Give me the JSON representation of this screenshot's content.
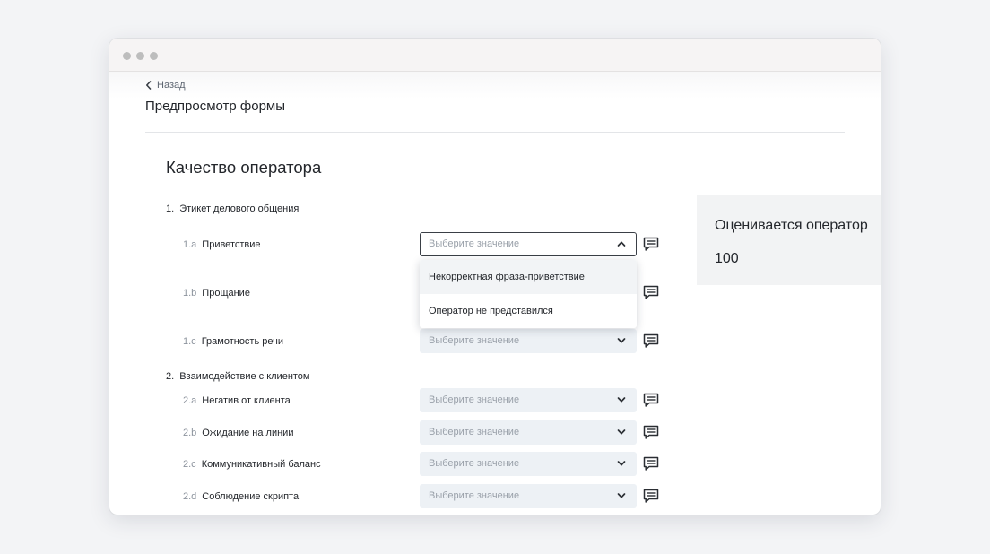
{
  "nav": {
    "back_label": "Назад"
  },
  "page": {
    "title": "Предпросмотр формы"
  },
  "form": {
    "title": "Качество оператора",
    "sections": [
      {
        "number": "1.",
        "title": "Этикет делового общения",
        "items": [
          {
            "code": "1.a",
            "label": "Приветствие",
            "placeholder": "Выберите значение"
          },
          {
            "code": "1.b",
            "label": "Прощание",
            "placeholder": "Выберите значение"
          },
          {
            "code": "1.c",
            "label": "Грамотность речи",
            "placeholder": "Выберите значение"
          }
        ]
      },
      {
        "number": "2.",
        "title": "Взаимодействие с клиентом",
        "items": [
          {
            "code": "2.a",
            "label": "Негатив от клиента",
            "placeholder": "Выберите значение"
          },
          {
            "code": "2.b",
            "label": "Ожидание на линии",
            "placeholder": "Выберите значение"
          },
          {
            "code": "2.c",
            "label": "Коммуникативный баланс",
            "placeholder": "Выберите значение"
          },
          {
            "code": "2.d",
            "label": "Соблюдение скрипта",
            "placeholder": "Выберите значение"
          }
        ]
      }
    ],
    "open_dropdown": {
      "options": [
        "Некорректная фраза-приветствие",
        "Оператор не представился"
      ]
    }
  },
  "panel": {
    "label": "Оценивается оператор",
    "value": "100"
  },
  "icons": {
    "back": "chevron-left-icon",
    "select_open": "chevron-up-icon",
    "select_closed": "chevron-down-icon",
    "comment": "comment-icon",
    "window_controls": "window-dot-icon"
  },
  "colors": {
    "select_bg": "#edf1f5",
    "panel_bg": "#f2f3f4",
    "placeholder": "#99a0a9",
    "text": "#23262b",
    "muted": "#8c939d"
  }
}
